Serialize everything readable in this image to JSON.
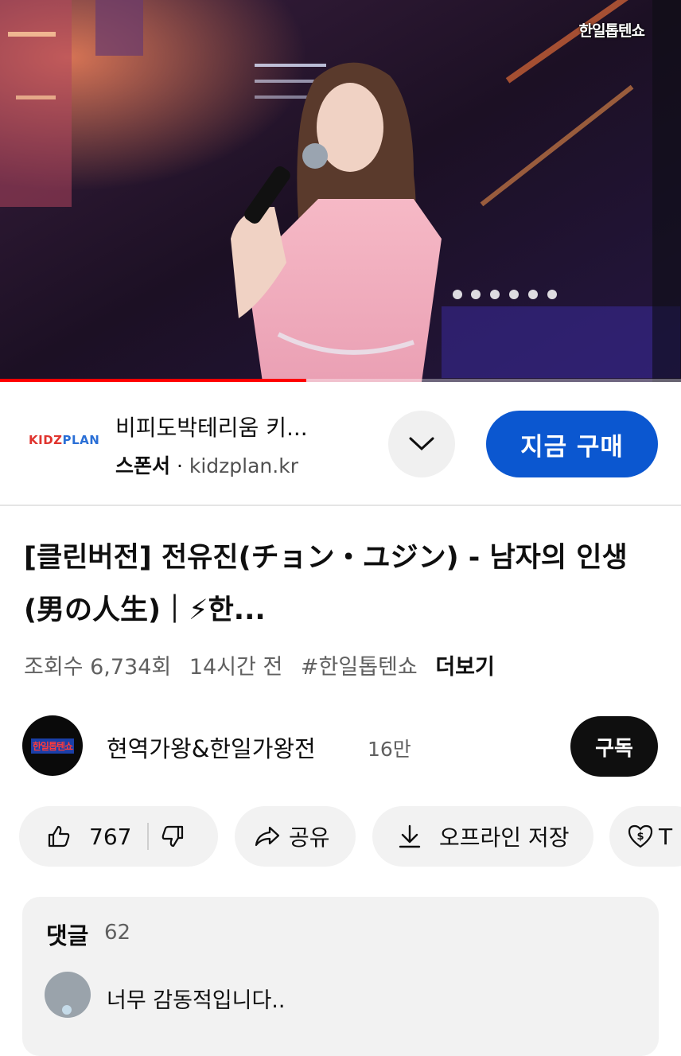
{
  "video": {
    "watermark": "한일톱텐쇼",
    "progress_fraction": 0.45
  },
  "ad": {
    "logo_part1": "KIDZ",
    "logo_part2": "PLAN",
    "title": "비피도박테리움 키...",
    "sponsor_label": "스폰서",
    "separator": "·",
    "domain": "kidzplan.kr",
    "expand_icon": "chevron-down-icon",
    "buy_label": "지금 구매"
  },
  "video_info": {
    "title": "[클린버전] 전유진(チョン・ユジン) - 남자의 인생(男の人生)｜⚡한...",
    "views": "조회수 6,734회",
    "time_ago": "14시간 전",
    "hashtag": "#한일톱텐쇼",
    "more_label": "더보기"
  },
  "channel": {
    "avatar_text": "한일톱텐쇼",
    "name": "현역가왕&한일가왕전",
    "subscribers": "16만",
    "subscribe_label": "구독"
  },
  "actions": {
    "like_count": "767",
    "share_label": "공유",
    "download_label": "오프라인 저장",
    "thanks_label": "T"
  },
  "comments": {
    "header": "댓글",
    "count": "62",
    "top_comment": "너무 감동적입니다.."
  },
  "colors": {
    "accent_blue": "#0b57d0",
    "progress_red": "#ff0000",
    "chip_bg": "#f2f2f2"
  }
}
